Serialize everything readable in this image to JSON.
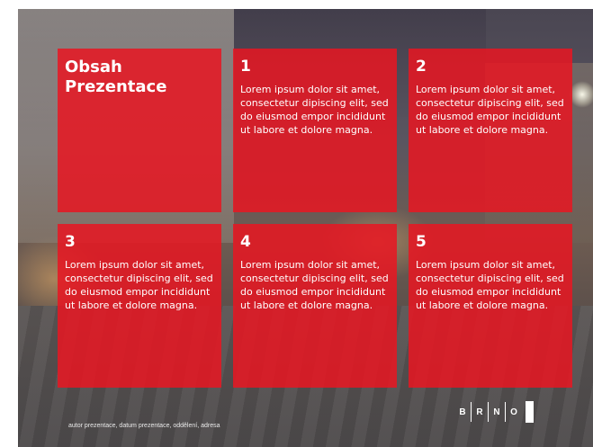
{
  "slide": {
    "title": "Obsah Prezentace",
    "items": [
      {
        "number": "1",
        "text": "Lorem ipsum dolor sit amet, consectetur dipiscing elit, sed do eiusmod empor incididunt ut labore et dolore magna."
      },
      {
        "number": "2",
        "text": "Lorem ipsum dolor sit amet, consectetur dipiscing elit, sed do eiusmod empor incididunt ut labore et dolore magna."
      },
      {
        "number": "3",
        "text": "Lorem ipsum dolor sit amet, consectetur dipiscing elit, sed do eiusmod empor incididunt ut labore et dolore magna."
      },
      {
        "number": "4",
        "text": "Lorem ipsum dolor sit amet, consectetur dipiscing elit, sed do eiusmod empor incididunt ut labore et dolore magna."
      },
      {
        "number": "5",
        "text": "Lorem ipsum dolor sit amet, consectetur dipiscing elit, sed do eiusmod empor incididunt ut labore et dolore magna."
      }
    ],
    "footer": "autor prezentace, datum prezentace, oddělení, adresa",
    "logo_letters": [
      "B",
      "R",
      "N",
      "O"
    ]
  },
  "colors": {
    "tile": "#e81622",
    "text": "#ffffff"
  }
}
